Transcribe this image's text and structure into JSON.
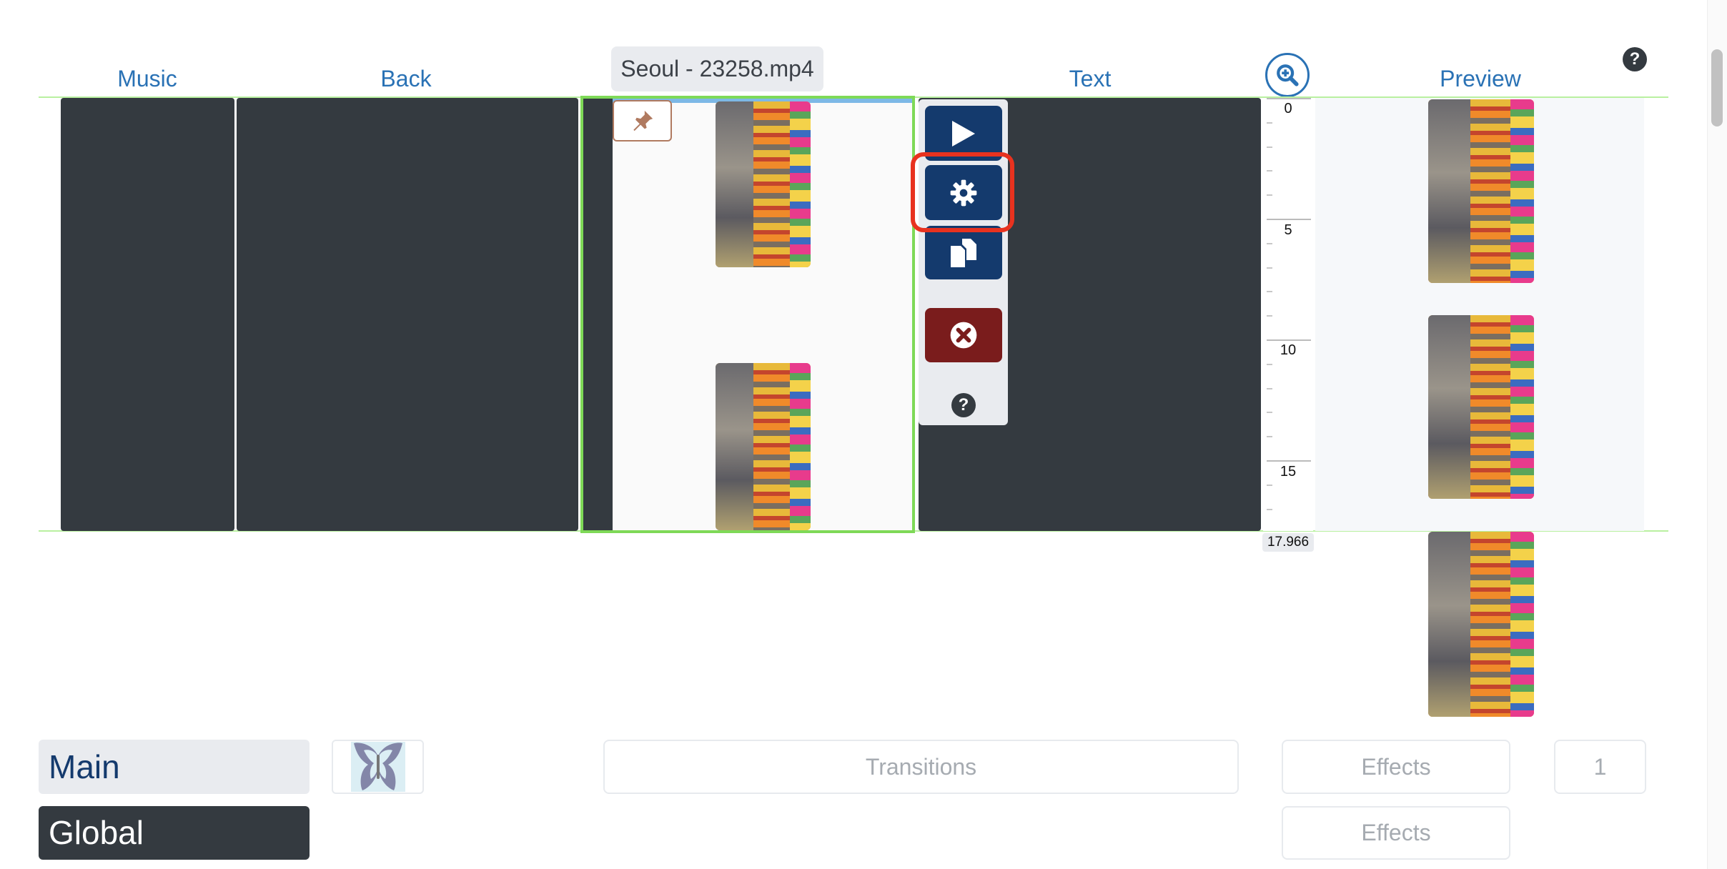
{
  "header": {
    "music": "Music",
    "back": "Back",
    "text": "Text",
    "preview": "Preview"
  },
  "clip": {
    "filename": "Seoul - 23258.mp4"
  },
  "toolbar": {
    "play": "play-icon",
    "settings": "gear-icon",
    "copy": "copy-icon",
    "delete": "delete-icon",
    "help": "?"
  },
  "ruler": {
    "labels": [
      "0",
      "5",
      "10",
      "15"
    ],
    "end": "17.966"
  },
  "help_top": "?",
  "bottom": {
    "main": "Main",
    "global": "Global",
    "transitions": "Transitions",
    "effects1": "Effects",
    "effects2": "Effects",
    "count": "1"
  },
  "colors": {
    "accent": "#2a72b5",
    "button": "#143a6d",
    "delete": "#7a1c1c",
    "selection": "#7ed957",
    "highlight": "#e8321f",
    "dark": "#343a40"
  }
}
